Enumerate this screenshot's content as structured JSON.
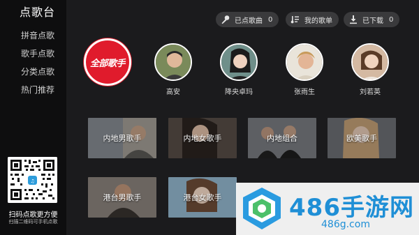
{
  "app": {
    "title": "点歌台"
  },
  "nav": [
    {
      "label": "拼音点歌"
    },
    {
      "label": "歌手点歌"
    },
    {
      "label": "分类点歌"
    },
    {
      "label": "热门推荐"
    }
  ],
  "qr": {
    "title": "扫码点歌更方便",
    "subtitle": "扫描二维码可手机点歌",
    "icon": "qr-code"
  },
  "top_buttons": {
    "ordered": {
      "label": "已点歌曲",
      "count": "0",
      "icon": "microphone-icon"
    },
    "playlist": {
      "label": "我的歌单",
      "icon": "music-note-icon"
    },
    "downloaded": {
      "label": "已下载",
      "count": "0",
      "icon": "download-icon"
    }
  },
  "all_singers": {
    "label": "全部歌手",
    "color": "#e01b2c"
  },
  "singers": [
    {
      "name": "高安"
    },
    {
      "name": "降央卓玛"
    },
    {
      "name": "张雨生"
    },
    {
      "name": "刘若英"
    }
  ],
  "categories": [
    {
      "label": "内地男歌手"
    },
    {
      "label": "内地女歌手"
    },
    {
      "label": "内地组合"
    },
    {
      "label": "欧美歌手"
    },
    {
      "label": "港台男歌手"
    },
    {
      "label": "港台女歌手"
    }
  ],
  "watermark": {
    "brand": "486手游网",
    "domain": "486g.com",
    "color": "#1f8fd6"
  }
}
